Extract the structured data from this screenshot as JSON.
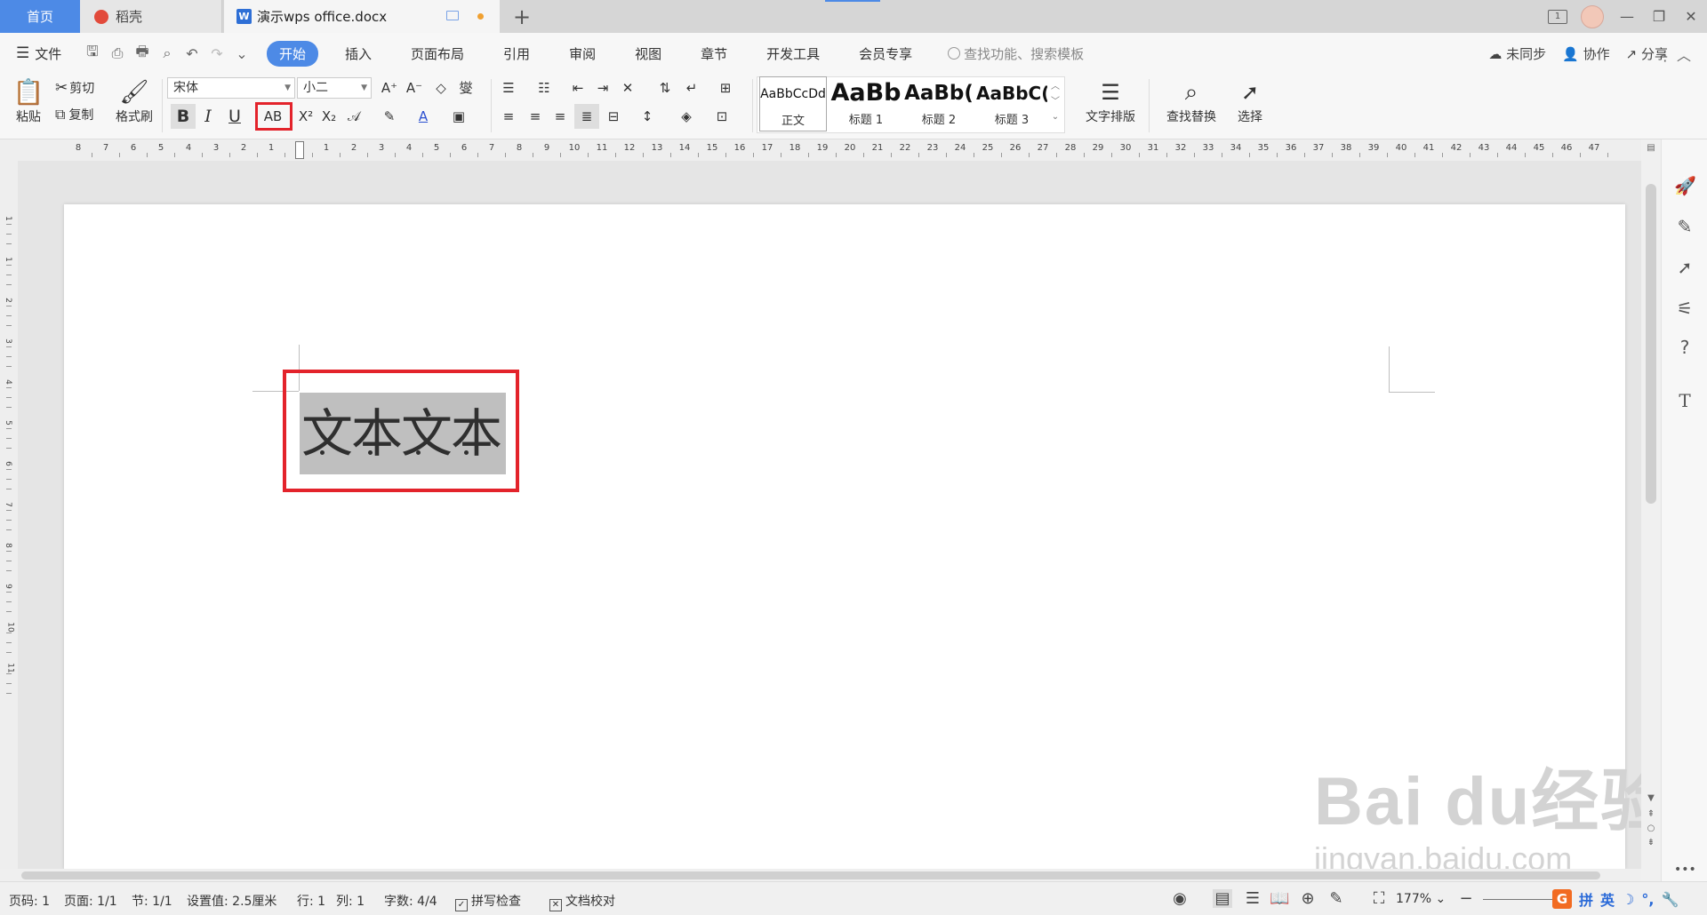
{
  "tabs": {
    "home": "首页",
    "daoke": "稻壳",
    "document": "演示wps office.docx",
    "add": "+"
  },
  "window": {
    "page_count_badge": "1",
    "min": "—",
    "restore": "❐",
    "close": "✕"
  },
  "menubar": {
    "file": "文件",
    "tabs": [
      "开始",
      "插入",
      "页面布局",
      "引用",
      "审阅",
      "视图",
      "章节",
      "开发工具",
      "会员专享"
    ],
    "search_placeholder": "查找功能、搜索模板",
    "sync": "未同步",
    "collab": "协作",
    "share": "分享"
  },
  "ribbon": {
    "paste": "粘贴",
    "cut": "剪切",
    "copy": "复制",
    "format_painter": "格式刷",
    "font_name": "宋体",
    "font_size": "小二",
    "bold": "B",
    "italic": "I",
    "underline": "U",
    "emphasis": "AB",
    "superscript": "X²",
    "subscript": "X₂",
    "styles": [
      {
        "sample": "AaBbCcDd",
        "name": "正文"
      },
      {
        "sample": "AaBb",
        "name": "标题 1"
      },
      {
        "sample": "AaBb(",
        "name": "标题 2"
      },
      {
        "sample": "AaBbC(",
        "name": "标题 3"
      }
    ],
    "text_layout": "文字排版",
    "find_replace": "查找替换",
    "select": "选择"
  },
  "ruler": {
    "labels": [
      "8",
      "7",
      "6",
      "5",
      "4",
      "3",
      "2",
      "1",
      "",
      "1",
      "2",
      "3",
      "4",
      "5",
      "6",
      "7",
      "8",
      "9",
      "10",
      "11",
      "12",
      "13",
      "14",
      "15",
      "16",
      "17",
      "18",
      "19",
      "20",
      "21",
      "22",
      "23",
      "24",
      "25",
      "26",
      "27",
      "28",
      "29",
      "30",
      "31",
      "32",
      "33",
      "34",
      "35",
      "36",
      "37",
      "38",
      "39",
      "40",
      "41",
      "42",
      "43",
      "44",
      "45",
      "46",
      "47"
    ]
  },
  "vruler": {
    "labels": [
      "1",
      "1",
      "2",
      "3",
      "4",
      "5",
      "6",
      "7",
      "8",
      "9",
      "10",
      "11"
    ]
  },
  "document": {
    "text": "文本文本"
  },
  "statusbar": {
    "page": "页码: 1",
    "pages": "页面: 1/1",
    "section": "节: 1/1",
    "setting": "设置值: 2.5厘米",
    "row": "行: 1",
    "col": "列: 1",
    "words": "字数: 4/4",
    "spell_check": "拼写检查",
    "doc_check": "文档校对",
    "zoom": "177%"
  },
  "ime": {
    "g": "G",
    "pin": "拼",
    "ying": "英"
  },
  "watermark": {
    "line1": "Bai du经验",
    "line2": "jingyan.baidu.com"
  },
  "colors": {
    "accent": "#4d8ae6",
    "highlight_frame": "#e3232b",
    "selection": "#bfbfbf"
  }
}
